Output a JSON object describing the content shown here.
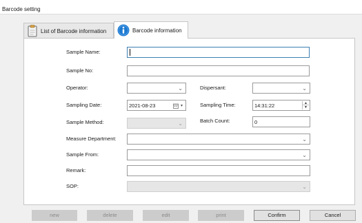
{
  "window": {
    "title": "Barcode setting"
  },
  "tabs": [
    {
      "label": "List of Barcode information",
      "icon": "clipboard-icon",
      "active": false
    },
    {
      "label": "Barcode information",
      "icon": "info-icon",
      "active": true
    }
  ],
  "form": {
    "sample_name": {
      "label": "Sample Name:",
      "value": ""
    },
    "sample_no": {
      "label": "Sample No:",
      "value": ""
    },
    "operator": {
      "label": "Operator:",
      "value": ""
    },
    "dispersant": {
      "label": "Dispersant:",
      "value": ""
    },
    "sampling_date": {
      "label": "Sampling Date:",
      "value": "2021-08-23"
    },
    "sampling_time": {
      "label": "Sampling Time:",
      "value": "14:31:22"
    },
    "sample_method": {
      "label": "Sample Method:",
      "value": ""
    },
    "batch_count": {
      "label": "Batch Count:",
      "value": "0"
    },
    "measure_department": {
      "label": "Measure Department:",
      "value": ""
    },
    "sample_from": {
      "label": "Sample From:",
      "value": ""
    },
    "remark": {
      "label": "Remark:",
      "value": ""
    },
    "sop": {
      "label": "SOP:",
      "value": ""
    }
  },
  "buttons": {
    "new": "new",
    "delete": "delete",
    "edit": "edit",
    "print": "print",
    "confirm": "Confirm",
    "cancel": "Cancel"
  },
  "colors": {
    "focus_border": "#3c7fb1",
    "info_icon": "#1e7ad1",
    "disabled_button": "#cccccc"
  }
}
